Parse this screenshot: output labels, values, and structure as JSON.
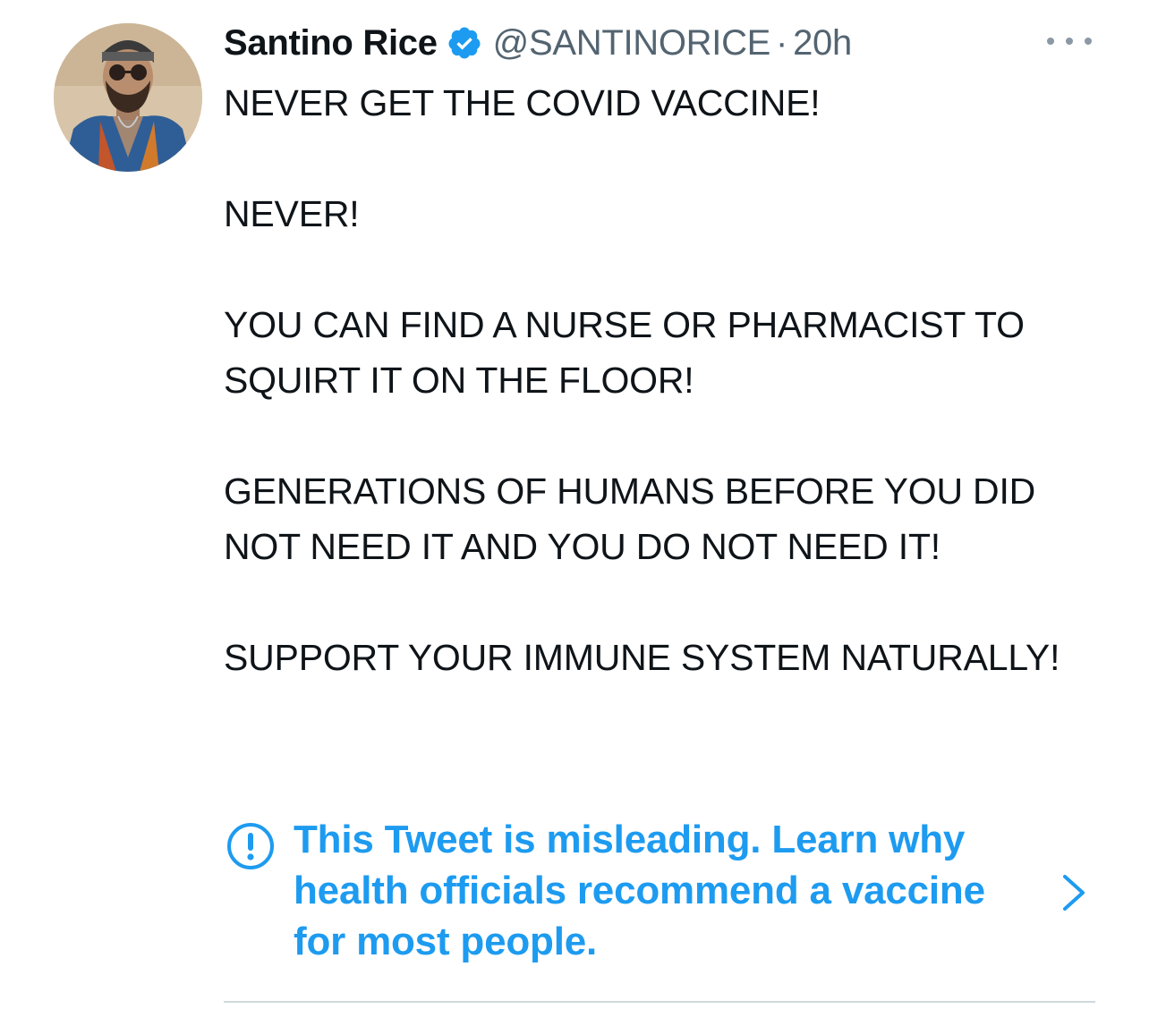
{
  "tweet": {
    "author": {
      "display_name": "Santino Rice",
      "handle": "@SANTINORICE",
      "verified_icon": "verified-badge-icon",
      "avatar_icon": "avatar-photo"
    },
    "separator": "·",
    "timestamp": "20h",
    "more_icon": "more-options-icon",
    "paragraphs": [
      "NEVER GET THE COVID VACCINE!",
      "NEVER!",
      "YOU CAN FIND A NURSE OR PHARMACIST TO SQUIRT IT ON THE FLOOR!",
      "GENERATIONS OF HUMANS BEFORE YOU DID NOT NEED IT AND YOU DO NOT NEED IT!",
      "SUPPORT YOUR IMMUNE SYSTEM NATURALLY!"
    ],
    "misleading_notice": {
      "icon": "exclamation-circle-icon",
      "text": "This Tweet is misleading. Learn why health officials recommend a vaccine for most people.",
      "chevron_icon": "chevron-right-icon"
    }
  },
  "colors": {
    "text": "#0f1419",
    "secondary": "#536471",
    "accent": "#1d9bf0",
    "divider": "#cfd9de"
  }
}
